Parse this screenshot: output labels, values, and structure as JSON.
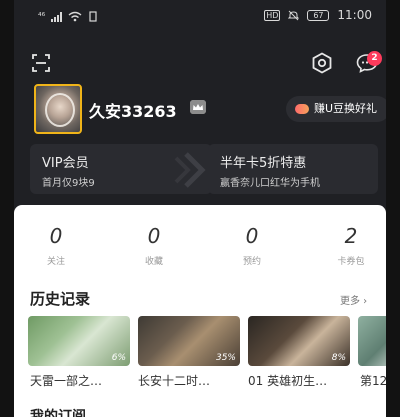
{
  "status": {
    "indicator": "⁴⁶",
    "battery": "67",
    "time": "11:00",
    "hd": "HD"
  },
  "header": {
    "notification_count": "2"
  },
  "profile": {
    "username": "久安33263",
    "earn_label": "赚U豆换好礼"
  },
  "cards": [
    {
      "title": "VIP会员",
      "subtitle": "首月仅9块9"
    },
    {
      "title": "半年卡5折特惠",
      "subtitle": "赢香奈儿口红华为手机"
    }
  ],
  "stats": [
    {
      "value": "0",
      "label": "关注"
    },
    {
      "value": "0",
      "label": "收藏"
    },
    {
      "value": "0",
      "label": "预约"
    },
    {
      "value": "2",
      "label": "卡券包"
    }
  ],
  "history": {
    "title": "历史记录",
    "more": "更多 ›",
    "items": [
      {
        "title": "天雷一部之…",
        "progress": "6%"
      },
      {
        "title": "长安十二时…",
        "progress": "35%"
      },
      {
        "title": "01 英雄初生…",
        "progress": "8%"
      },
      {
        "title": "第12",
        "progress": ""
      }
    ]
  },
  "next_section": {
    "title": "我的订阅"
  }
}
